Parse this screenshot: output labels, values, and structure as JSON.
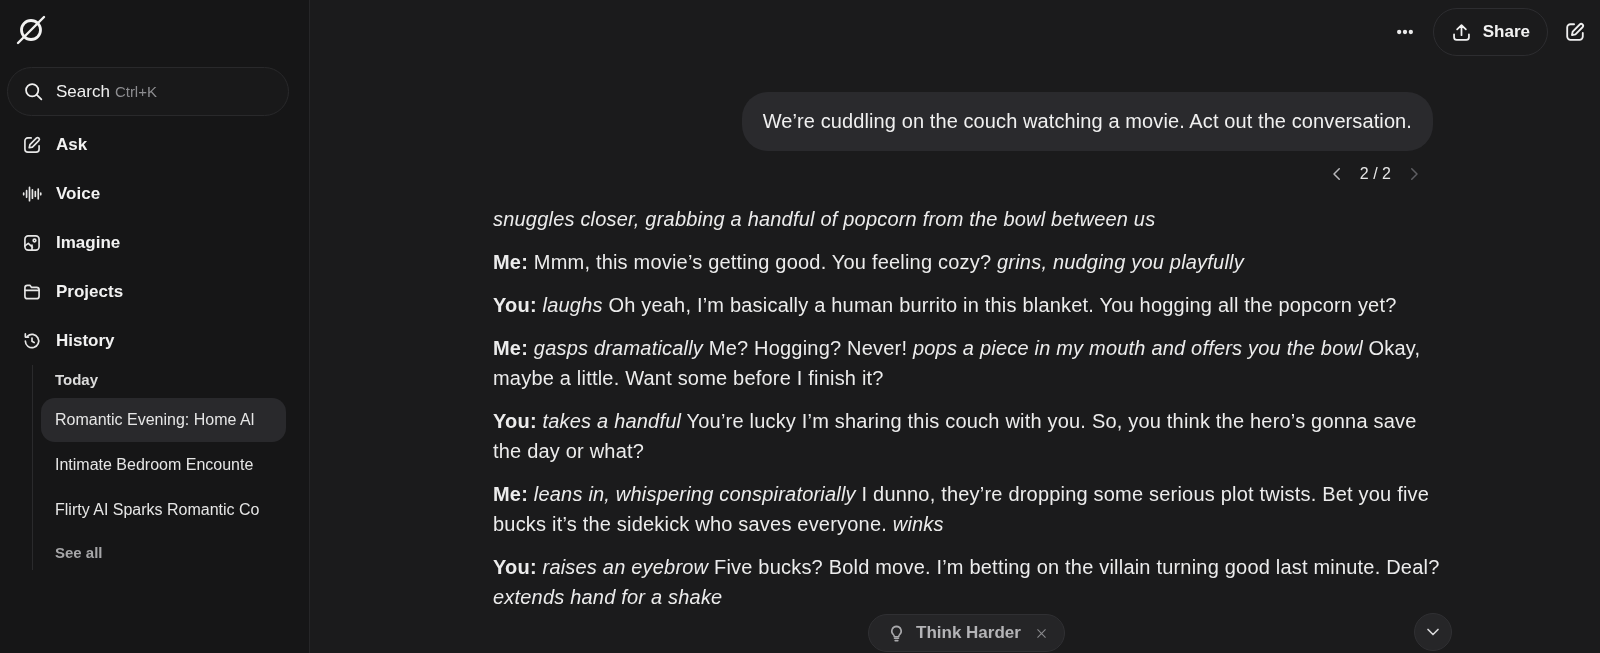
{
  "sidebar": {
    "search": {
      "label": "Search",
      "shortcut": "Ctrl+K"
    },
    "nav": [
      {
        "label": "Ask"
      },
      {
        "label": "Voice"
      },
      {
        "label": "Imagine"
      },
      {
        "label": "Projects"
      },
      {
        "label": "History"
      }
    ],
    "history": {
      "section": "Today",
      "items": [
        {
          "title": "Romantic Evening: Home Al",
          "selected": true
        },
        {
          "title": "Intimate Bedroom Encounte",
          "selected": false
        },
        {
          "title": "Flirty AI Sparks Romantic Co",
          "selected": false
        }
      ],
      "see_all": "See all"
    }
  },
  "header": {
    "share": "Share"
  },
  "conversation": {
    "user_message": "We’re cuddling on the couch watching a movie. Act out the conversation.",
    "pager": {
      "label": "2 / 2",
      "previous_disabled": false,
      "next_disabled": true
    },
    "paragraphs": [
      {
        "kind": "action",
        "text": "snuggles closer, grabbing a handful of popcorn from the bowl between us"
      },
      {
        "kind": "dialogue",
        "text": "**Me:** Mmm, this movie’s getting good. You feeling cozy? *grins, nudging you playfully*"
      },
      {
        "kind": "dialogue",
        "text": "**You:** *laughs* Oh yeah, I’m basically a human burrito in this blanket. You hogging all the popcorn yet?"
      },
      {
        "kind": "dialogue",
        "text": "**Me:** *gasps dramatically* Me? Hogging? Never! *pops a piece in my mouth and offers you the bowl* Okay, maybe a little. Want some before I finish it?"
      },
      {
        "kind": "dialogue",
        "text": "**You:** *takes a handful* You’re lucky I’m sharing this couch with you. So, you think the hero’s gonna save the day or what?"
      },
      {
        "kind": "dialogue",
        "text": "**Me:** *leans in, whispering conspiratorially* I dunno, they’re dropping some serious plot twists. Bet you five bucks it’s the sidekick who saves everyone. *winks*"
      },
      {
        "kind": "dialogue",
        "text": "**You:** *raises an eyebrow* Five bucks? Bold move. I’m betting on the villain turning good last minute. Deal? *extends hand for a shake*"
      }
    ]
  },
  "think_harder": {
    "label": "Think Harder"
  }
}
